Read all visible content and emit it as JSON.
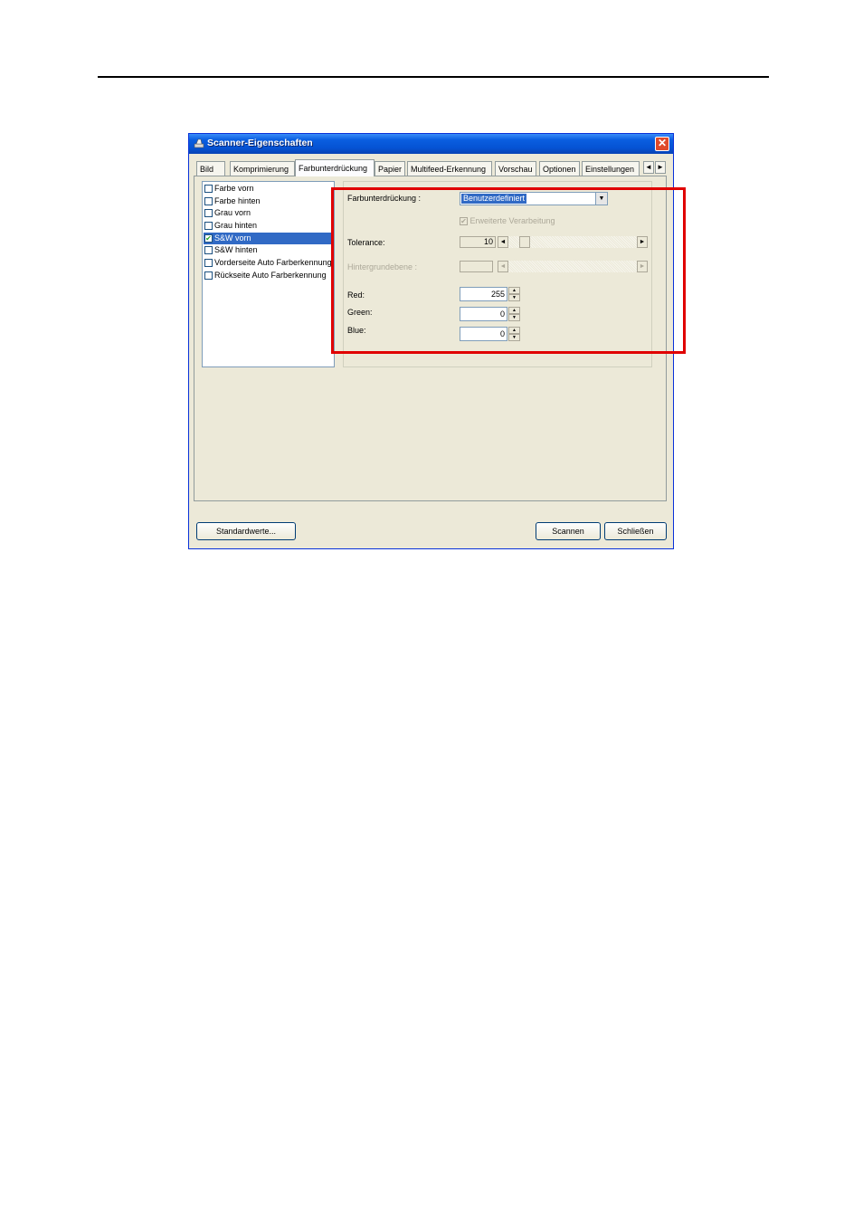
{
  "window": {
    "title": "Scanner-Eigenschaften",
    "close_glyph": "✕"
  },
  "tabs": [
    {
      "label": "Bild"
    },
    {
      "label": "Komprimierung"
    },
    {
      "label": "Farbunterdrückung",
      "active": true
    },
    {
      "label": "Papier"
    },
    {
      "label": "Multifeed-Erkennung"
    },
    {
      "label": "Vorschau"
    },
    {
      "label": "Optionen"
    },
    {
      "label": "Einstellungen"
    }
  ],
  "tab_scroll": {
    "left": "◄",
    "right": "►"
  },
  "image_list": [
    {
      "label": "Farbe vorn",
      "checked": false
    },
    {
      "label": "Farbe hinten",
      "checked": false
    },
    {
      "label": "Grau vorn",
      "checked": false
    },
    {
      "label": "Grau hinten",
      "checked": false
    },
    {
      "label": "S&W vorn",
      "checked": true,
      "selected": true
    },
    {
      "label": "S&W hinten",
      "checked": false
    },
    {
      "label": "Vorderseite Auto Farberkennung",
      "checked": false
    },
    {
      "label": "Rückseite Auto Farberkennung",
      "checked": false
    }
  ],
  "settings": {
    "color_dropout_label": "Farbunterdrückung :",
    "color_dropout_value": "Benutzerdefiniert",
    "advanced_processing_label": "Erweiterte Verarbeitung",
    "advanced_processing_checked": true,
    "tolerance_label": "Tolerance:",
    "tolerance_value": "10",
    "background_level_label": "Hintergrundebene :",
    "background_level_value": "",
    "red_label": "Red:",
    "red_value": "255",
    "green_label": "Green:",
    "green_value": "0",
    "blue_label": "Blue:",
    "blue_value": "0"
  },
  "buttons": {
    "defaults": "Standardwerte...",
    "scan": "Scannen",
    "close": "Schließen"
  },
  "colors": {
    "highlight_frame": "#e00000",
    "title_bar": "#0553d4",
    "selection": "#316ac5"
  }
}
